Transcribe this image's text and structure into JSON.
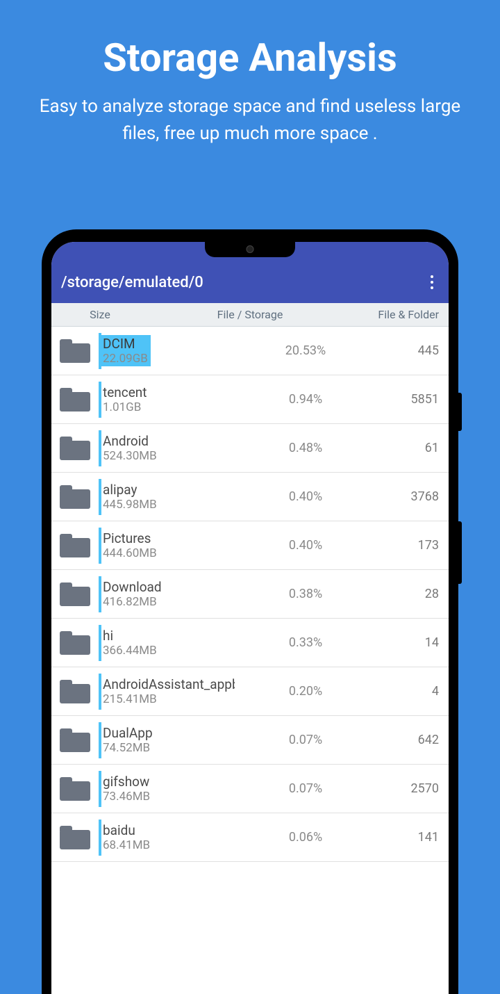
{
  "promo": {
    "title": "Storage Analysis",
    "subtitle": "Easy to analyze storage space and find useless large files, free up much more space ."
  },
  "appbar": {
    "path": "/storage/emulated/0"
  },
  "columns": {
    "size": "Size",
    "ratio": "File / Storage",
    "count": "File & Folder"
  },
  "entries": [
    {
      "name": "DCIM",
      "size": "22.09GB",
      "pct": "20.53%",
      "count": "445",
      "highlight": true
    },
    {
      "name": "tencent",
      "size": "1.01GB",
      "pct": "0.94%",
      "count": "5851"
    },
    {
      "name": "Android",
      "size": "524.30MB",
      "pct": "0.48%",
      "count": "61"
    },
    {
      "name": "alipay",
      "size": "445.98MB",
      "pct": "0.40%",
      "count": "3768"
    },
    {
      "name": "Pictures",
      "size": "444.60MB",
      "pct": "0.40%",
      "count": "173"
    },
    {
      "name": "Download",
      "size": "416.82MB",
      "pct": "0.38%",
      "count": "28"
    },
    {
      "name": "hi",
      "size": "366.44MB",
      "pct": "0.33%",
      "count": "14"
    },
    {
      "name": "AndroidAssistant_appbackup",
      "size": "215.41MB",
      "pct": "0.20%",
      "count": "4"
    },
    {
      "name": "DualApp",
      "size": "74.52MB",
      "pct": "0.07%",
      "count": "642"
    },
    {
      "name": "gifshow",
      "size": "73.46MB",
      "pct": "0.07%",
      "count": "2570"
    },
    {
      "name": "baidu",
      "size": "68.41MB",
      "pct": "0.06%",
      "count": "141"
    }
  ]
}
